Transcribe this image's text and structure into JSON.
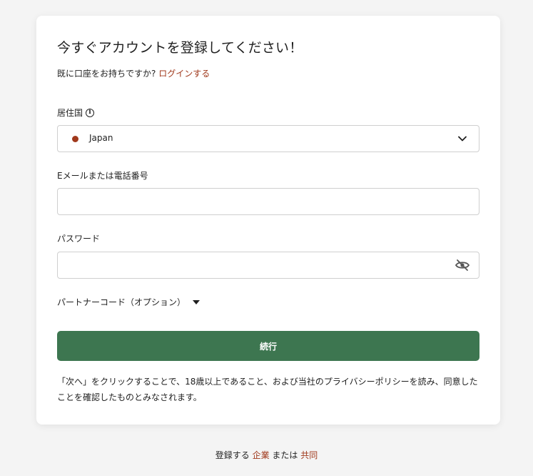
{
  "form": {
    "title": "今すぐアカウントを登録してください！",
    "login_prompt": "既に口座をお持ちですか? ",
    "login_link": "ログインする",
    "country": {
      "label": "居住国",
      "info_glyph": "i",
      "selected": "Japan",
      "accent_color": "#a0391c"
    },
    "email": {
      "label": "Eメールまたは電話番号",
      "value": "",
      "placeholder": ""
    },
    "password": {
      "label": "パスワード",
      "value": "",
      "placeholder": ""
    },
    "partner_code": {
      "label": "パートナーコード（オプション）"
    },
    "continue_label": "続行",
    "button_color": "#3d7650",
    "legal_text": "「次へ」をクリックすることで、18歳以上であること、および当社のプライバシーポリシーを読み、同意したことを確認したものとみなされます。"
  },
  "footer": {
    "prefix": "登録する ",
    "corporate_link": "企業",
    "middle": " または ",
    "joint_link": "共同"
  },
  "icons": {
    "info": "info-icon",
    "chevron": "chevron-down-icon",
    "visibility": "eye-slash-icon",
    "caret": "caret-down-icon"
  }
}
